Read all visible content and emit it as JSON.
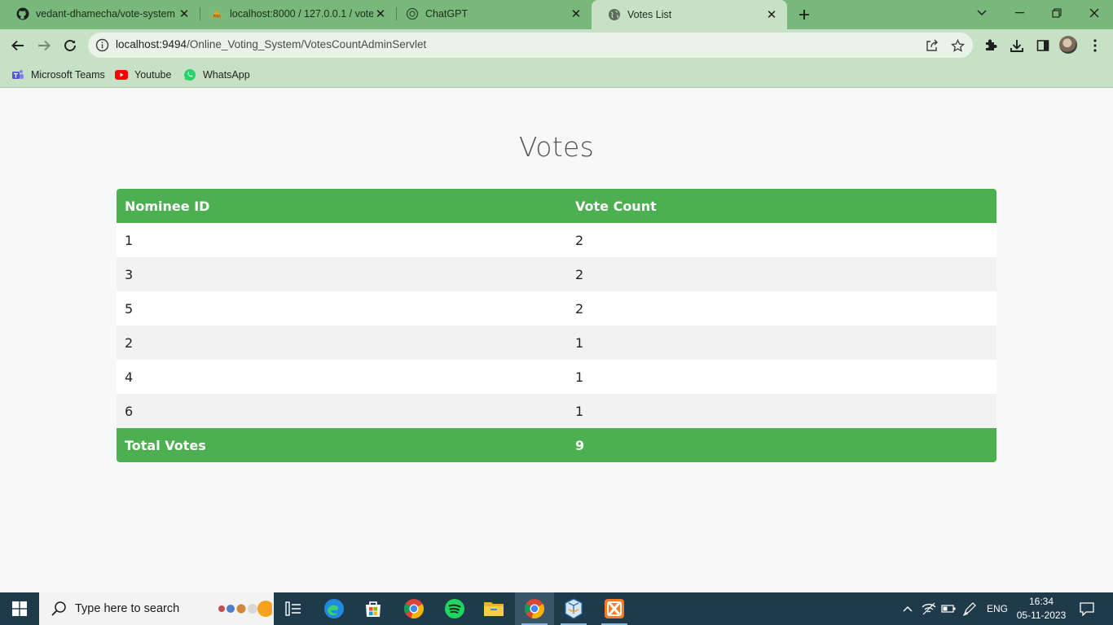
{
  "browser": {
    "tabs": [
      {
        "title": "vedant-dhamecha/vote-system",
        "icon": "github-icon"
      },
      {
        "title": "localhost:8000 / 127.0.0.1 / vote",
        "icon": "phpmyadmin-icon"
      },
      {
        "title": "ChatGPT",
        "icon": "chatgpt-icon"
      },
      {
        "title": "Votes List",
        "icon": "globe-icon",
        "active": true
      }
    ],
    "address": {
      "host": "localhost:9494",
      "path": "/Online_Voting_System/VotesCountAdminServlet"
    },
    "bookmarks": [
      {
        "label": "Microsoft Teams",
        "icon": "teams-icon"
      },
      {
        "label": "Youtube",
        "icon": "youtube-icon"
      },
      {
        "label": "WhatsApp",
        "icon": "whatsapp-icon"
      }
    ]
  },
  "page": {
    "title": "Votes",
    "table": {
      "headers": [
        "Nominee ID",
        "Vote Count"
      ],
      "rows": [
        [
          "1",
          "2"
        ],
        [
          "3",
          "2"
        ],
        [
          "5",
          "2"
        ],
        [
          "2",
          "1"
        ],
        [
          "4",
          "1"
        ],
        [
          "6",
          "1"
        ]
      ],
      "footer": [
        "Total Votes",
        "9"
      ]
    },
    "colors": {
      "header": "#4caf50",
      "row_alt": "#f2f2f2"
    }
  },
  "taskbar": {
    "search_placeholder": "Type here to search",
    "language": "ENG",
    "time": "16:34",
    "date": "05-11-2023"
  }
}
